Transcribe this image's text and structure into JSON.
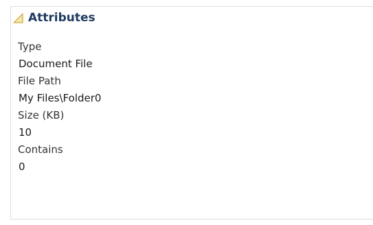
{
  "panel": {
    "title": "Attributes",
    "collapse_icon": "collapse-triangle-icon",
    "attributes": [
      {
        "label": "Type",
        "value": "Document File"
      },
      {
        "label": "File Path",
        "value": "My Files\\Folder0"
      },
      {
        "label": "Size (KB)",
        "value": "10"
      },
      {
        "label": "Contains",
        "value": "0"
      }
    ]
  },
  "colors": {
    "title": "#1e3a5f",
    "icon_fill": "#f5e7a8",
    "icon_stroke": "#d0a640",
    "border": "#dcdcdc"
  }
}
